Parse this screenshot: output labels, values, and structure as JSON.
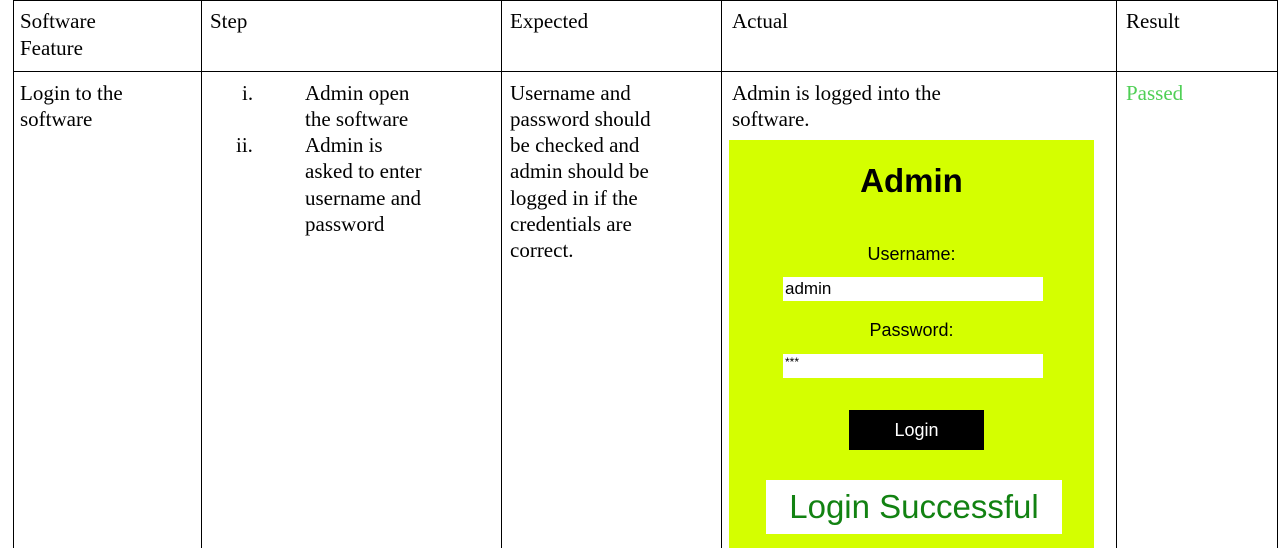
{
  "table": {
    "headers": {
      "feature_line1": "Software",
      "feature_line2": "Feature",
      "step": "Step",
      "expected": "Expected",
      "actual": "Actual",
      "result": "Result"
    },
    "row": {
      "feature_line1": "Login to the",
      "feature_line2": "software",
      "steps": [
        {
          "marker": "i.",
          "lines": [
            "Admin open",
            "the software"
          ]
        },
        {
          "marker": "ii.",
          "lines": [
            "Admin is",
            "asked to enter",
            "username and",
            "password"
          ]
        }
      ],
      "expected_lines": [
        "Username and",
        "password should",
        "be checked and",
        "admin should be",
        "logged in if the",
        "credentials are",
        "correct."
      ],
      "actual_lines": [
        "Admin is logged into the",
        "software."
      ],
      "result": "Passed"
    }
  },
  "screenshot": {
    "title": "Admin",
    "username_label": "Username:",
    "username_value": "admin",
    "password_label": "Password:",
    "password_value": "***",
    "login_button": "Login",
    "message": "Login Successful",
    "colors": {
      "background": "#d4ff00",
      "message": "#128212",
      "button": "#000000"
    }
  },
  "colors": {
    "passed": "#4fcf55"
  }
}
